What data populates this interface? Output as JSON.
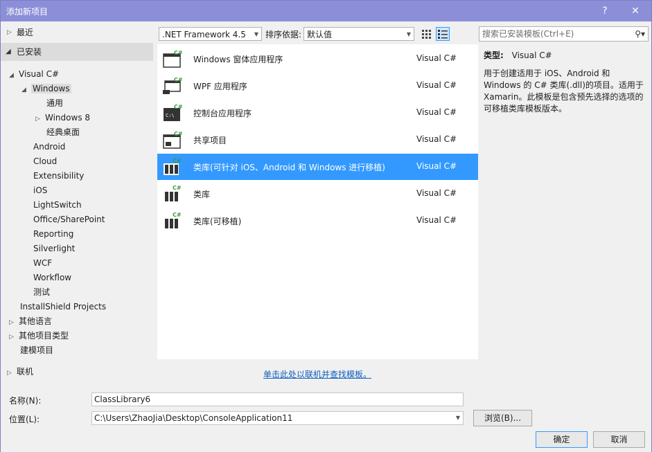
{
  "window": {
    "title": "添加新项目",
    "help_label": "?",
    "close_label": "✕"
  },
  "sidebar": {
    "recent": "最近",
    "installed": "已安装",
    "visual_csharp": "Visual C#",
    "windows": "Windows",
    "windows_children": [
      "通用",
      "Windows 8",
      "经典桌面"
    ],
    "csharp_children": [
      "Android",
      "Cloud",
      "Extensibility",
      "iOS",
      "LightSwitch",
      "Office/SharePoint",
      "Reporting",
      "Silverlight",
      "WCF",
      "Workflow",
      "测试"
    ],
    "installshield": "InstallShield Projects",
    "other_languages": "其他语言",
    "other_project_types": "其他项目类型",
    "modeling_projects": "建模项目",
    "online": "联机"
  },
  "toolbar": {
    "framework": ".NET Framework 4.5",
    "sort_label": "排序依据:",
    "sort_value": "默认值"
  },
  "search": {
    "placeholder": "搜索已安装模板(Ctrl+E)"
  },
  "templates": [
    {
      "name": "Windows 窗体应用程序",
      "lang": "Visual C#",
      "icon": "windows-forms-icon"
    },
    {
      "name": "WPF 应用程序",
      "lang": "Visual C#",
      "icon": "wpf-app-icon"
    },
    {
      "name": "控制台应用程序",
      "lang": "Visual C#",
      "icon": "console-app-icon"
    },
    {
      "name": "共享项目",
      "lang": "Visual C#",
      "icon": "shared-project-icon"
    },
    {
      "name": "类库(可针对 iOS、Android 和 Windows 进行移植)",
      "lang": "Visual C#",
      "icon": "portable-class-library-icon",
      "selected": true
    },
    {
      "name": "类库",
      "lang": "Visual C#",
      "icon": "class-library-icon"
    },
    {
      "name": "类库(可移植)",
      "lang": "Visual C#",
      "icon": "portable-library-icon"
    }
  ],
  "online_link": "单击此处以联机并查找模板。",
  "details": {
    "type_label": "类型:",
    "type_value": "Visual C#",
    "description": "用于创建适用于 iOS、Android 和 Windows 的 C# 类库(.dll)的项目。适用于 Xamarin。此模板是包含预先选择的选项的可移植类库模板版本。"
  },
  "form": {
    "name_label": "名称(N):",
    "name_value": "ClassLibrary6",
    "location_label": "位置(L):",
    "location_value": "C:\\Users\\ZhaoJia\\Desktop\\ConsoleApplication11",
    "browse_label": "浏览(B)...",
    "ok_label": "确定",
    "cancel_label": "取消"
  },
  "colors": {
    "titlebar": "#8c8fd7",
    "selection": "#3399ff",
    "link": "#0e5fbe"
  }
}
